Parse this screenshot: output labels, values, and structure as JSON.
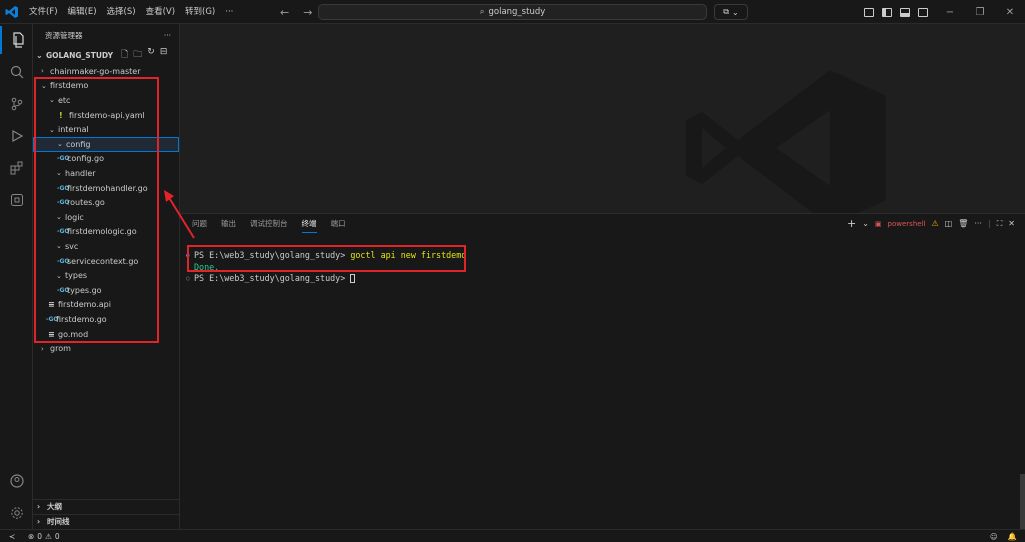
{
  "menu": [
    "文件(F)",
    "编辑(E)",
    "选择(S)",
    "查看(V)",
    "转到(G)",
    "···"
  ],
  "search": {
    "label": "golang_study"
  },
  "sidebar": {
    "title": "资源管理器",
    "more": "···",
    "workspace": "GOLANG_STUDY",
    "tree": [
      {
        "label": "chainmaker-go-master",
        "chev": "›",
        "icon": ""
      },
      {
        "label": "firstdemo",
        "chev": "⌄",
        "icon": ""
      },
      {
        "label": "etc",
        "chev": "⌄",
        "icon": ""
      },
      {
        "label": "firstdemo-api.yaml",
        "chev": "",
        "icon": "!"
      },
      {
        "label": "internal",
        "chev": "⌄",
        "icon": ""
      },
      {
        "label": "config",
        "chev": "⌄",
        "icon": ""
      },
      {
        "label": "config.go",
        "chev": "",
        "icon": "-GO"
      },
      {
        "label": "handler",
        "chev": "⌄",
        "icon": ""
      },
      {
        "label": "firstdemohandler.go",
        "chev": "",
        "icon": "-GO"
      },
      {
        "label": "routes.go",
        "chev": "",
        "icon": "-GO"
      },
      {
        "label": "logic",
        "chev": "⌄",
        "icon": ""
      },
      {
        "label": "firstdemologic.go",
        "chev": "",
        "icon": "-GO"
      },
      {
        "label": "svc",
        "chev": "⌄",
        "icon": ""
      },
      {
        "label": "servicecontext.go",
        "chev": "",
        "icon": "-GO"
      },
      {
        "label": "types",
        "chev": "⌄",
        "icon": ""
      },
      {
        "label": "types.go",
        "chev": "",
        "icon": "-GO"
      },
      {
        "label": "firstdemo.api",
        "chev": "",
        "icon": "≡"
      },
      {
        "label": "firstdemo.go",
        "chev": "",
        "icon": "-GO"
      },
      {
        "label": "go.mod",
        "chev": "",
        "icon": "≡"
      },
      {
        "label": "grom",
        "chev": "›",
        "icon": ""
      }
    ],
    "outline": "大纲",
    "timeline": "时间线"
  },
  "panel": {
    "tabs": [
      "问题",
      "输出",
      "调试控制台",
      "终端",
      "端口"
    ],
    "active_tab": "终端",
    "shell": "powershell",
    "terminal": {
      "prompt": "PS E:\\web3_study\\golang_study> ",
      "command": "goctl api new firstdemo",
      "output": "Done.",
      "prompt2": "PS E:\\web3_study\\golang_study> "
    }
  },
  "status": {
    "errors": "0",
    "warnings": "0"
  },
  "colors": {
    "accent": "#0078d4",
    "highlight": "#e0242a",
    "command": "#e5e510",
    "done": "#23d18b"
  }
}
